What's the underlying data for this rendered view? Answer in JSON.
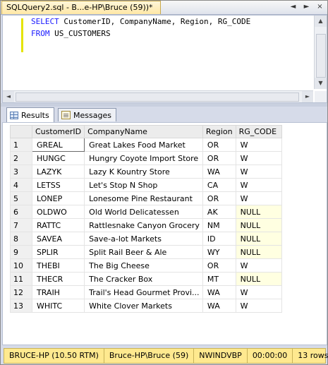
{
  "window": {
    "tab_title": "SQLQuery2.sql - B...e-HP\\Bruce (59))*",
    "controls": [
      "◄",
      "►",
      "×"
    ]
  },
  "editor": {
    "line1": {
      "keyword": "SELECT",
      "rest": " CustomerID, CompanyName, Region, RG_CODE"
    },
    "line2": {
      "keyword": "FROM",
      "rest": " US_CUSTOMERS"
    }
  },
  "results_tabs": [
    {
      "label": "Results",
      "icon": "grid-icon",
      "active": true
    },
    {
      "label": "Messages",
      "icon": "messages-icon",
      "active": false
    }
  ],
  "grid": {
    "columns": [
      "CustomerID",
      "CompanyName",
      "Region",
      "RG_CODE"
    ],
    "rows": [
      [
        "1",
        "GREAL",
        "Great Lakes Food Market",
        "OR",
        "W"
      ],
      [
        "2",
        "HUNGC",
        "Hungry Coyote Import Store",
        "OR",
        "W"
      ],
      [
        "3",
        "LAZYK",
        "Lazy K Kountry Store",
        "WA",
        "W"
      ],
      [
        "4",
        "LETSS",
        "Let's Stop N Shop",
        "CA",
        "W"
      ],
      [
        "5",
        "LONEP",
        "Lonesome Pine Restaurant",
        "OR",
        "W"
      ],
      [
        "6",
        "OLDWO",
        "Old World Delicatessen",
        "AK",
        "NULL"
      ],
      [
        "7",
        "RATTC",
        "Rattlesnake Canyon Grocery",
        "NM",
        "NULL"
      ],
      [
        "8",
        "SAVEA",
        "Save-a-lot Markets",
        "ID",
        "NULL"
      ],
      [
        "9",
        "SPLIR",
        "Split Rail Beer & Ale",
        "WY",
        "NULL"
      ],
      [
        "10",
        "THEBI",
        "The Big Cheese",
        "OR",
        "W"
      ],
      [
        "11",
        "THECR",
        "The Cracker Box",
        "MT",
        "NULL"
      ],
      [
        "12",
        "TRAIH",
        "Trail's Head Gourmet Provi...",
        "WA",
        "W"
      ],
      [
        "13",
        "WHITC",
        "White Clover Markets",
        "WA",
        "W"
      ]
    ]
  },
  "status": {
    "server": "BRUCE-HP (10.50 RTM)",
    "user": "Bruce-HP\\Bruce (59)",
    "database": "NWINDVBP",
    "elapsed": "00:00:00",
    "rows": "13 rows"
  },
  "colors": {
    "keyword": "#1a1aff",
    "status_bar": "#ffe98f",
    "null_cell": "#ffffe1"
  }
}
